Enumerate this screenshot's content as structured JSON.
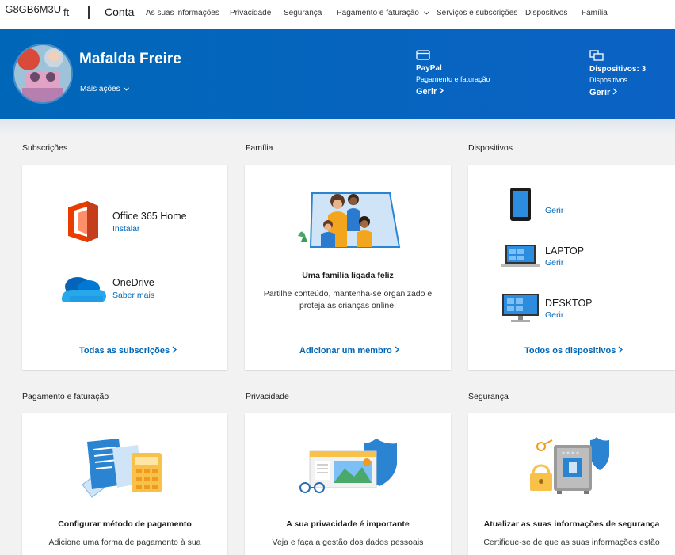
{
  "topbar": {
    "account_id": "-G8GB6M3U",
    "brand_fragment": "ft",
    "conta": "Conta",
    "nav": [
      {
        "label": "As suas informações"
      },
      {
        "label": "Privacidade"
      },
      {
        "label": "Segurança"
      },
      {
        "label": "Pagamento e faturação"
      },
      {
        "label": "Serviços e subscrições"
      },
      {
        "label": "Dispositivos"
      },
      {
        "label": "Família"
      }
    ]
  },
  "hero": {
    "name": "Mafalda Freire",
    "more_actions": "Mais ações",
    "payment": {
      "title": "PayPal",
      "subtitle": "Pagamento e faturação",
      "manage": "Gerir"
    },
    "devices": {
      "title": "Dispositivos: 3",
      "subtitle": "Dispositivos",
      "manage": "Gerir"
    }
  },
  "sections": {
    "subscriptions": {
      "title": "Subscrições",
      "items": [
        {
          "name": "Office 365 Home",
          "action": "Instalar"
        },
        {
          "name": "OneDrive",
          "action": "Saber mais"
        }
      ],
      "link": "Todas as subscrições"
    },
    "family": {
      "title": "Família",
      "heading": "Uma família ligada feliz",
      "text_line1": "Partilhe conteúdo, mantenha-se organizado e",
      "text_line2": "proteja as crianças online.",
      "link": "Adicionar um membro"
    },
    "devices": {
      "title": "Dispositivos",
      "items": [
        {
          "name": "",
          "action": "Gerir"
        },
        {
          "name": "LAPTOP",
          "action": "Gerir"
        },
        {
          "name": "DESKTOP",
          "action": "Gerir"
        }
      ],
      "link": "Todos os dispositivos"
    },
    "payment": {
      "title": "Pagamento e faturação",
      "heading": "Configurar método de pagamento",
      "text": "Adicione uma forma de pagamento à sua"
    },
    "privacy": {
      "title": "Privacidade",
      "heading": "A sua privacidade é importante",
      "text": "Veja e faça a gestão dos dados pessoais"
    },
    "security": {
      "title": "Segurança",
      "heading": "Atualizar as suas informações de segurança",
      "text": "Certifique-se de que as suas informações estão"
    }
  },
  "colors": {
    "brand": "#0067b8",
    "background": "#f2f2f2"
  }
}
